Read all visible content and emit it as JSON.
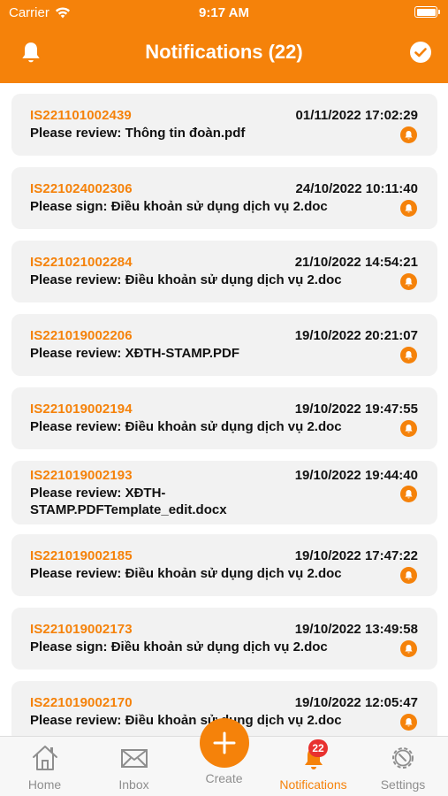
{
  "status_bar": {
    "carrier": "Carrier",
    "time": "9:17 AM"
  },
  "header": {
    "title": "Notifications (22)"
  },
  "notifications": [
    {
      "code": "IS221101002439",
      "date": "01/11/2022 17:02:29",
      "message": "Please review: Thông tin đoàn.pdf"
    },
    {
      "code": "IS221024002306",
      "date": "24/10/2022 10:11:40",
      "message": "Please sign: Điều khoản sử dụng dịch vụ 2.doc"
    },
    {
      "code": "IS221021002284",
      "date": "21/10/2022 14:54:21",
      "message": "Please review: Điều khoản sử dụng dịch vụ 2.doc"
    },
    {
      "code": "IS221019002206",
      "date": "19/10/2022 20:21:07",
      "message": "Please review: XĐTH-STAMP.PDF"
    },
    {
      "code": "IS221019002194",
      "date": "19/10/2022 19:47:55",
      "message": "Please review: Điều khoản sử dụng dịch vụ 2.doc"
    },
    {
      "code": "IS221019002193",
      "date": "19/10/2022 19:44:40",
      "message_line1": "Please review: XĐTH-",
      "message_line2": "STAMP.PDFTemplate_edit.docx"
    },
    {
      "code": "IS221019002185",
      "date": "19/10/2022 17:47:22",
      "message": "Please review: Điều khoản sử dụng dịch vụ 2.doc"
    },
    {
      "code": "IS221019002173",
      "date": "19/10/2022 13:49:58",
      "message": "Please sign: Điều khoản sử dụng dịch vụ 2.doc"
    },
    {
      "code": "IS221019002170",
      "date": "19/10/2022 12:05:47",
      "message": "Please review: Điều khoản sử dụng dịch vụ 2.doc"
    }
  ],
  "tabbar": {
    "home": "Home",
    "inbox": "Inbox",
    "create": "Create",
    "notifications": "Notifications",
    "settings": "Settings",
    "badge_count": "22"
  },
  "colors": {
    "accent": "#f5820a",
    "badge": "#e8312f",
    "card": "#f2f2f2"
  },
  "icons": [
    "wifi-icon",
    "battery-icon",
    "bell-icon",
    "check-circle-icon",
    "home-icon",
    "inbox-icon",
    "plus-icon",
    "notifications-bell-icon",
    "settings-gear-icon"
  ]
}
